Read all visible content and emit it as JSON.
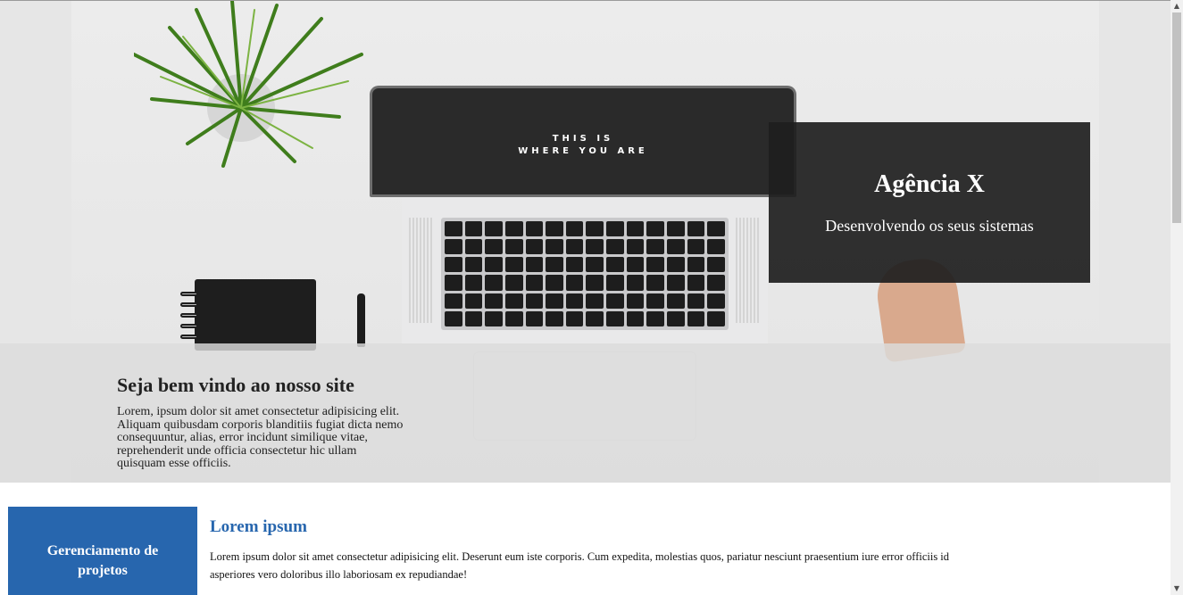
{
  "hero": {
    "screen_text_line1": "THIS IS",
    "screen_text_line2": "WHERE YOU ARE",
    "brand": {
      "title": "Agência X",
      "subtitle": "Desenvolvendo os seus sistemas"
    },
    "welcome": {
      "title": "Seja bem vindo ao nosso site",
      "text": "Lorem, ipsum dolor sit amet consectetur adipisicing elit. Aliquam quibusdam corporis blanditiis fugiat dicta nemo consequuntur, alias, error incidunt similique vitae, reprehenderit unde officia consectetur hic ullam quisquam esse officiis."
    }
  },
  "section": {
    "card_label": "Gerenciamento de projetos",
    "title": "Lorem ipsum",
    "text": "Lorem ipsum dolor sit amet consectetur adipisicing elit. Deserunt eum iste corporis. Cum expedita, molestias quos, pariatur nesciunt praesentium iure error officiis id asperiores vero doloribus illo laboriosam ex repudiandae!"
  },
  "colors": {
    "accent": "#2766ae",
    "brand_box": "#1e1e1e"
  },
  "scrollbar": {
    "up_icon": "▲",
    "down_icon": "▼"
  }
}
